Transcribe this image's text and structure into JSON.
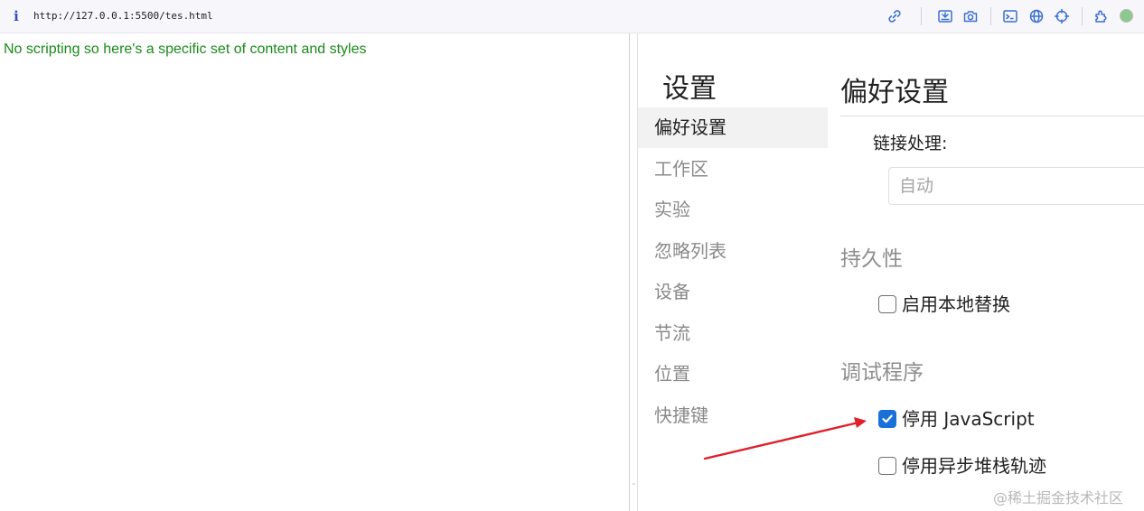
{
  "browser": {
    "url": "http://127.0.0.1:5500/tes.html",
    "info_icon_glyph": "i",
    "toolbar_icons": [
      "link-icon",
      "screenshot-node-icon",
      "camera-icon",
      "console-icon",
      "globe-icon",
      "crosshair-icon",
      "extension-icon"
    ]
  },
  "page": {
    "message": "No scripting so here's a specific set of content and styles"
  },
  "settings": {
    "title": "设置",
    "nav": [
      {
        "label": "偏好设置",
        "active": true
      },
      {
        "label": "工作区",
        "active": false
      },
      {
        "label": "实验",
        "active": false
      },
      {
        "label": "忽略列表",
        "active": false
      },
      {
        "label": "设备",
        "active": false
      },
      {
        "label": "节流",
        "active": false
      },
      {
        "label": "位置",
        "active": false
      },
      {
        "label": "快捷键",
        "active": false
      }
    ],
    "pane": {
      "title": "偏好设置",
      "link_handling_label": "链接处理:",
      "link_handling_value": "自动",
      "persistence": {
        "heading": "持久性",
        "enable_local_overrides": {
          "label": "启用本地替换",
          "checked": false
        }
      },
      "debugger": {
        "heading": "调试程序",
        "disable_javascript": {
          "label": "停用 JavaScript",
          "checked": true
        },
        "disable_async_stack_traces": {
          "label": "停用异步堆栈轨迹",
          "checked": false
        }
      }
    }
  },
  "annotation": {
    "arrow_color": "#e0202a"
  },
  "watermark": "@稀土掘金技术社区",
  "colors": {
    "accent": "#1b6fd8",
    "page_text": "#1a8a1a",
    "status_dot": "#8dc98c"
  }
}
